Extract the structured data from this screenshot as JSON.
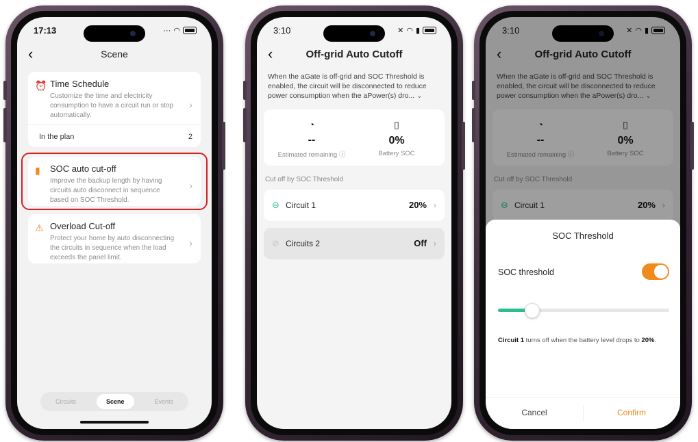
{
  "phones": {
    "scene": {
      "status_time": "17:13",
      "title": "Scene",
      "time_schedule": {
        "title": "Time Schedule",
        "description": "Customize the time and electricity consumption to have a circuit run or stop automatically.",
        "plan_label": "In the plan",
        "plan_count": "2"
      },
      "soc_cutoff": {
        "title": "SOC auto cut-off",
        "description": "Improve the backup length by having circuits auto disconnect in sequence based on SOC Threshold."
      },
      "overload": {
        "title": "Overload Cut-off",
        "description": "Protect your home by auto disconnecting the circuits in sequence when the load exceeds the panel limit."
      },
      "tabs": [
        "Circuits",
        "Scene",
        "Events"
      ],
      "active_tab": "Scene"
    },
    "cutoff": {
      "status_time": "3:10",
      "title": "Off-grid Auto Cutoff",
      "intro": "When the aGate is off-grid and SOC Threshold is enabled, the circuit will be disconnected to reduce power consumption when the aPower(s) dro...",
      "estimated_value": "--",
      "estimated_label": "Estimated remaining",
      "battery_value": "0%",
      "battery_label": "Battery SOC",
      "section_label": "Cut off by SOC Threshold",
      "circuits": [
        {
          "name": "Circuit 1",
          "value": "20%",
          "enabled": true
        },
        {
          "name": "Circuits 2",
          "value": "Off",
          "enabled": false
        }
      ]
    },
    "sheet": {
      "status_time": "3:10",
      "title": "Off-grid Auto Cutoff",
      "sheet_title": "SOC Threshold",
      "toggle_label": "SOC threshold",
      "toggle_on": true,
      "slider_value_percent": 20,
      "note_circuit": "Circuit 1",
      "note_text": " turns off when the battery level drops to ",
      "note_value": "20%",
      "note_end": ".",
      "cancel_label": "Cancel",
      "confirm_label": "Confirm"
    }
  },
  "colors": {
    "accent_orange": "#f08a1d",
    "accent_green": "#2bbf8f",
    "highlight_red": "#d42020",
    "phone_frame": "#3b2c3a"
  }
}
